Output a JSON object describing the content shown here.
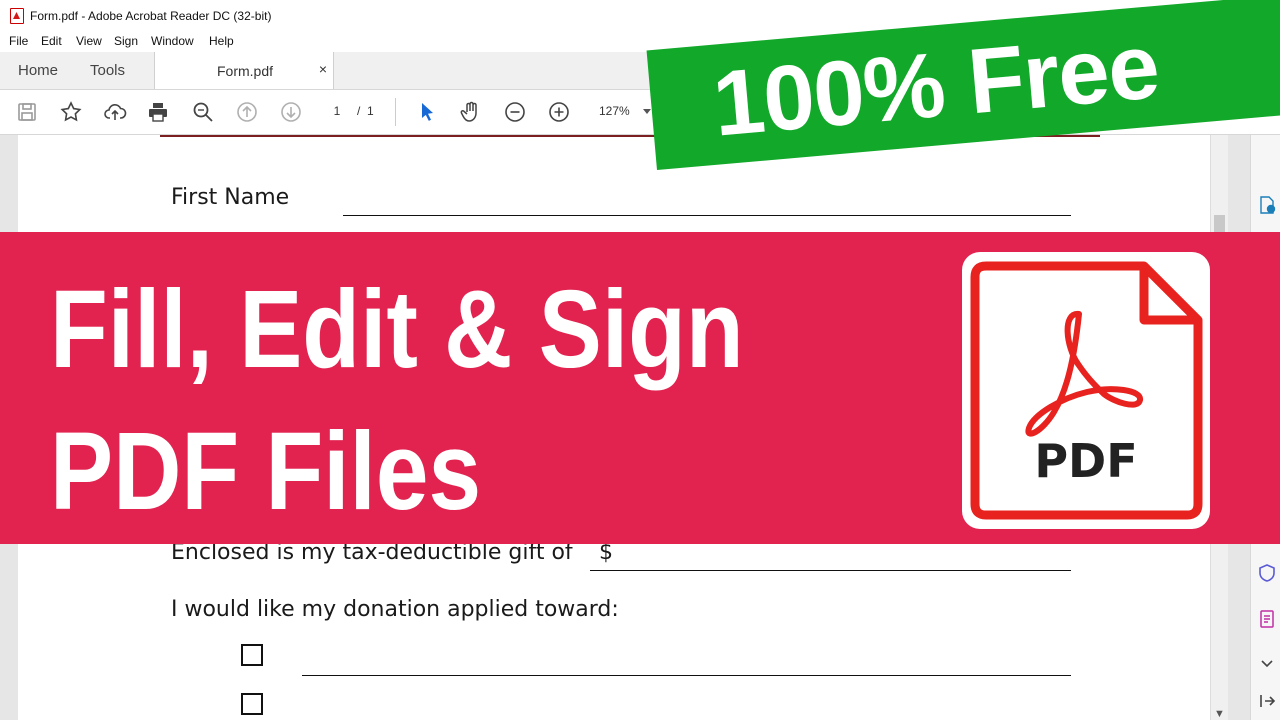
{
  "window": {
    "title": "Form.pdf - Adobe Acrobat Reader DC (32-bit)"
  },
  "menu": [
    "File",
    "Edit",
    "View",
    "Sign",
    "Window",
    "Help"
  ],
  "tabs": {
    "home": "Home",
    "tools": "Tools",
    "document": "Form.pdf",
    "close": "×"
  },
  "toolbar": {
    "current_page": "1",
    "page_separator": "/",
    "total_pages": "1",
    "zoom": "127%"
  },
  "form": {
    "first_name_label": "First Name",
    "gift_label": "Enclosed is my tax-deductible gift of",
    "currency": "$",
    "donation_label": "I would like my donation applied toward:"
  },
  "promo": {
    "free_text": "100% Free",
    "headline_line1": "Fill, Edit & Sign",
    "headline_line2": "PDF Files",
    "pdf_icon_text": "PDF"
  },
  "colors": {
    "green_banner": "#12a82a",
    "red_banner": "#e2224f",
    "acrobat_red": "#e8221e"
  },
  "icons": [
    "save-icon",
    "bookmark-star-icon",
    "upload-cloud-icon",
    "print-icon",
    "zoom-search-icon",
    "page-up-icon",
    "page-down-icon",
    "select-arrow-icon",
    "hand-icon",
    "zoom-out-icon",
    "zoom-in-icon",
    "export-pdf-icon",
    "protect-shield-icon",
    "edit-form-icon",
    "chevron-down-icon",
    "collapse-pane-icon"
  ]
}
